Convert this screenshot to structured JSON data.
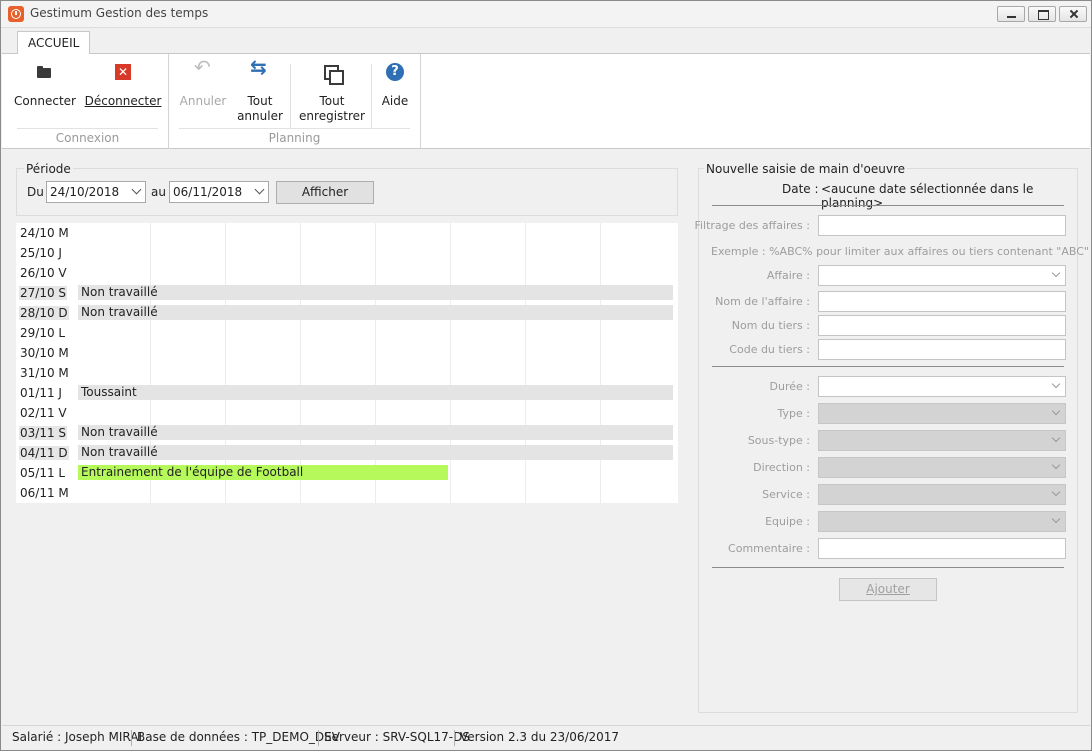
{
  "window": {
    "title": "Gestimum Gestion des temps"
  },
  "ribbon": {
    "tab": "ACCUEIL",
    "groups": {
      "connexion": "Connexion",
      "planning": "Planning"
    },
    "buttons": {
      "connecter": "Connecter",
      "deconnecter": "Déconnecter",
      "annuler": "Annuler",
      "tout_annuler_1": "Tout",
      "tout_annuler_2": "annuler",
      "tout_enregistrer_1": "Tout",
      "tout_enregistrer_2": "enregistrer",
      "aide": "Aide"
    }
  },
  "periode": {
    "legend": "Période",
    "du_label": "Du",
    "du_value": "24/10/2018",
    "au_label": "au",
    "au_value": "06/11/2018",
    "afficher": "Afficher"
  },
  "planning": {
    "rows": [
      {
        "date": "24/10 M",
        "weekend": false,
        "event": ""
      },
      {
        "date": "25/10 J",
        "weekend": false,
        "event": ""
      },
      {
        "date": "26/10 V",
        "weekend": false,
        "event": ""
      },
      {
        "date": "27/10 S",
        "weekend": true,
        "event": "Non travaillé"
      },
      {
        "date": "28/10 D",
        "weekend": true,
        "event": "Non travaillé"
      },
      {
        "date": "29/10 L",
        "weekend": false,
        "event": ""
      },
      {
        "date": "30/10 M",
        "weekend": false,
        "event": ""
      },
      {
        "date": "31/10 M",
        "weekend": false,
        "event": ""
      },
      {
        "date": "01/11 J",
        "weekend": false,
        "event": "Toussaint"
      },
      {
        "date": "02/11 V",
        "weekend": false,
        "event": ""
      },
      {
        "date": "03/11 S",
        "weekend": true,
        "event": "Non travaillé"
      },
      {
        "date": "04/11 D",
        "weekend": true,
        "event": "Non travaillé"
      },
      {
        "date": "05/11 L",
        "weekend": false,
        "event": "Entrainement de l'équipe de Football"
      },
      {
        "date": "06/11 M",
        "weekend": false,
        "event": ""
      }
    ],
    "colors": {
      "non_travaille": "#e4e4e4",
      "event": "#b6f95a"
    }
  },
  "saisie": {
    "legend": "Nouvelle saisie de main d'oeuvre",
    "date_label": "Date :",
    "date_value": "<aucune date sélectionnée dans le planning>",
    "filtrage_label": "Filtrage des affaires :",
    "exemple": "Exemple : %ABC% pour limiter aux affaires ou tiers contenant \"ABC\"",
    "affaire_label": "Affaire :",
    "nom_affaire_label": "Nom de l'affaire :",
    "nom_tiers_label": "Nom du tiers :",
    "code_tiers_label": "Code du tiers :",
    "duree_label": "Durée :",
    "type_label": "Type :",
    "sous_type_label": "Sous-type :",
    "direction_label": "Direction :",
    "service_label": "Service :",
    "equipe_label": "Equipe :",
    "commentaire_label": "Commentaire :",
    "ajouter": "Ajouter"
  },
  "status": {
    "salarie": "Salarié : Joseph MIRAI",
    "base": "Base de données : TP_DEMO_DEV",
    "serveur": "Serveur : SRV-SQL17-DS",
    "version": "Version 2.3 du 23/06/2017"
  }
}
